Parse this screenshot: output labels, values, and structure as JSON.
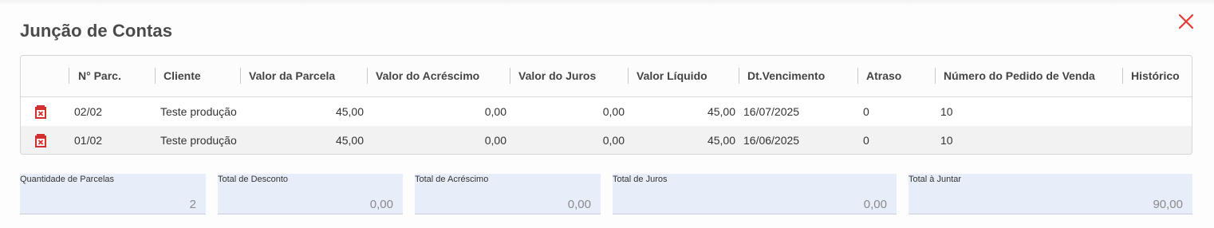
{
  "window": {
    "title": "Junção de Contas"
  },
  "table": {
    "headers": {
      "parcela": "N° Parc.",
      "cliente": "Cliente",
      "valor_parcela": "Valor da Parcela",
      "valor_acrescimo": "Valor do Acréscimo",
      "valor_juros": "Valor do Juros",
      "valor_liquido": "Valor Líquido",
      "vencimento": "Dt.Vencimento",
      "atraso": "Atraso",
      "pedido": "Número do Pedido de Venda",
      "historico": "Histórico"
    },
    "rows": [
      {
        "parcela": "02/02",
        "cliente": "Teste produção",
        "valor_parcela": "45,00",
        "valor_acrescimo": "0,00",
        "valor_juros": "0,00",
        "valor_liquido": "45,00",
        "vencimento": "16/07/2025",
        "atraso": "0",
        "pedido": "10",
        "historico": ""
      },
      {
        "parcela": "01/02",
        "cliente": "Teste produção",
        "valor_parcela": "45,00",
        "valor_acrescimo": "0,00",
        "valor_juros": "0,00",
        "valor_liquido": "45,00",
        "vencimento": "16/06/2025",
        "atraso": "0",
        "pedido": "10",
        "historico": ""
      }
    ]
  },
  "totals": {
    "quantidade": {
      "label": "Quantidade de Parcelas",
      "value": "2"
    },
    "desconto": {
      "label": "Total de Desconto",
      "value": "0,00"
    },
    "acrescimo": {
      "label": "Total de Acréscimo",
      "value": "0,00"
    },
    "juros": {
      "label": "Total de Juros",
      "value": "0,00"
    },
    "juntar": {
      "label": "Total à Juntar",
      "value": "90,00"
    }
  },
  "icons": {
    "close": "close-icon",
    "delete": "trash-icon"
  },
  "colors": {
    "close": "#e53935",
    "delete": "#d32f2f",
    "field_bg": "#e8eef9",
    "row_alt": "#f2f2f2"
  }
}
